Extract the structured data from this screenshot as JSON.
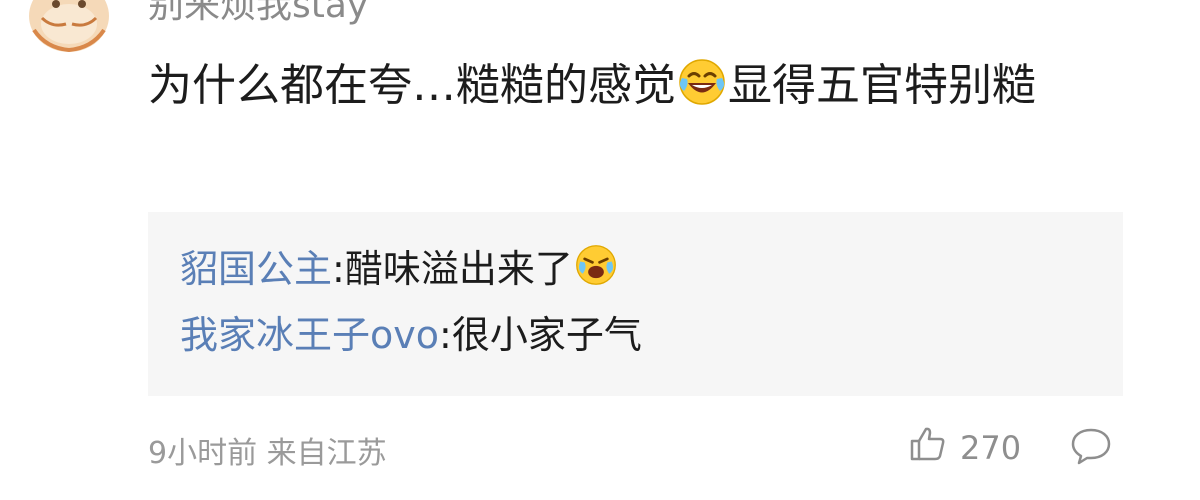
{
  "comment": {
    "username": "别来烦我stay",
    "text_part1": "为什么都在夸…糙糙的感觉",
    "text_part2": "显得五官特别糙",
    "emoji_icon": "laughing-crying-emoji-icon"
  },
  "replies": [
    {
      "user": "貂国公主",
      "separator": ":",
      "text": "醋味溢出来了"
    },
    {
      "user": "我家冰王子ovo",
      "separator": ":",
      "text": "很小家子气"
    }
  ],
  "meta": {
    "time": "9小时前",
    "location": "来自江苏"
  },
  "actions": {
    "like_count": "270",
    "like_icon": "thumbs-up-icon",
    "comment_icon": "comment-bubble-icon"
  },
  "colors": {
    "reply_user": "#5a7fb6",
    "reply_bg": "#f6f6f6",
    "meta": "#9a9a9a",
    "text": "#1c1c1c"
  }
}
